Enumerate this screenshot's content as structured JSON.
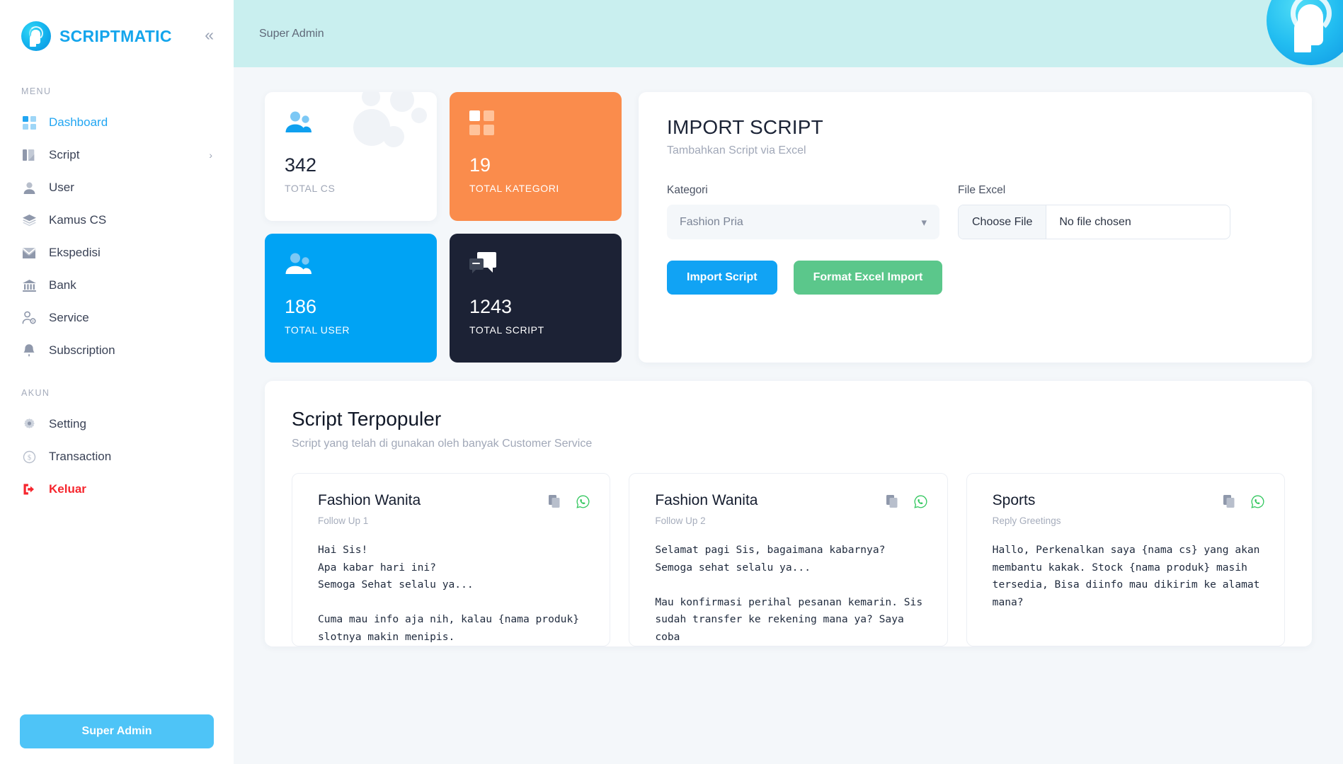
{
  "brand": {
    "name": "SCRIPTMATIC",
    "collapse_icon": "chevrons-left-icon"
  },
  "sidebar": {
    "menu_heading": "MENU",
    "account_heading": "AKUN",
    "menu_items": [
      {
        "label": "Dashboard",
        "icon": "grid-icon",
        "active": true
      },
      {
        "label": "Script",
        "icon": "script-icon",
        "chevron": "›"
      },
      {
        "label": "User",
        "icon": "user-icon"
      },
      {
        "label": "Kamus CS",
        "icon": "layers-icon"
      },
      {
        "label": "Ekspedisi",
        "icon": "mail-icon"
      },
      {
        "label": "Bank",
        "icon": "bank-icon"
      },
      {
        "label": "Service",
        "icon": "user-cog-icon"
      },
      {
        "label": "Subscription",
        "icon": "bell-icon"
      }
    ],
    "account_items": [
      {
        "label": "Setting",
        "icon": "gear-icon"
      },
      {
        "label": "Transaction",
        "icon": "dollar-circle-icon"
      },
      {
        "label": "Keluar",
        "icon": "logout-icon",
        "danger": true
      }
    ],
    "footer_button": "Super Admin"
  },
  "topbar": {
    "breadcrumb": "Super Admin"
  },
  "stats": [
    {
      "value": "342",
      "caption": "TOTAL CS",
      "style": "white",
      "icon": "users-icon"
    },
    {
      "value": "19",
      "caption": "TOTAL KATEGORI",
      "style": "orange",
      "icon": "grid-icon"
    },
    {
      "value": "186",
      "caption": "TOTAL USER",
      "style": "blue",
      "icon": "users-icon"
    },
    {
      "value": "1243",
      "caption": "TOTAL SCRIPT",
      "style": "dark",
      "icon": "chat-icon"
    }
  ],
  "import_panel": {
    "title": "IMPORT SCRIPT",
    "subtitle": "Tambahkan Script via Excel",
    "kategori_label": "Kategori",
    "kategori_value": "Fashion Pria",
    "file_label": "File Excel",
    "file_button": "Choose File",
    "file_status": "No file chosen",
    "import_button": "Import Script",
    "format_button": "Format Excel Import"
  },
  "popular": {
    "title": "Script Terpopuler",
    "subtitle": "Script yang telah di gunakan oleh banyak Customer Service",
    "cards": [
      {
        "title": "Fashion Wanita",
        "category": "Follow Up 1",
        "body": "Hai Sis!\nApa kabar hari ini?\nSemoga Sehat selalu ya...\n\nCuma mau info aja nih, kalau {nama produk} slotnya makin menipis."
      },
      {
        "title": "Fashion Wanita",
        "category": "Follow Up 2",
        "body": "Selamat pagi Sis, bagaimana kabarnya? Semoga sehat selalu ya...\n\nMau konfirmasi perihal pesanan kemarin. Sis sudah transfer ke rekening mana ya? Saya coba"
      },
      {
        "title": "Sports",
        "category": "Reply Greetings",
        "body": "Hallo, Perkenalkan saya {nama cs} yang akan membantu kakak. Stock {nama produk} masih tersedia, Bisa diinfo mau dikirim ke alamat mana?"
      }
    ],
    "copy_icon": "copy-icon",
    "whatsapp_icon": "whatsapp-icon"
  },
  "colors": {
    "brand_blue": "#14a5ec",
    "accent_orange": "#fa8c4c",
    "accent_blue": "#00a3f4",
    "accent_dark": "#1c2235",
    "accent_green": "#5bc78b",
    "danger_red": "#f6262e",
    "topbar_teal": "#c9efef"
  }
}
